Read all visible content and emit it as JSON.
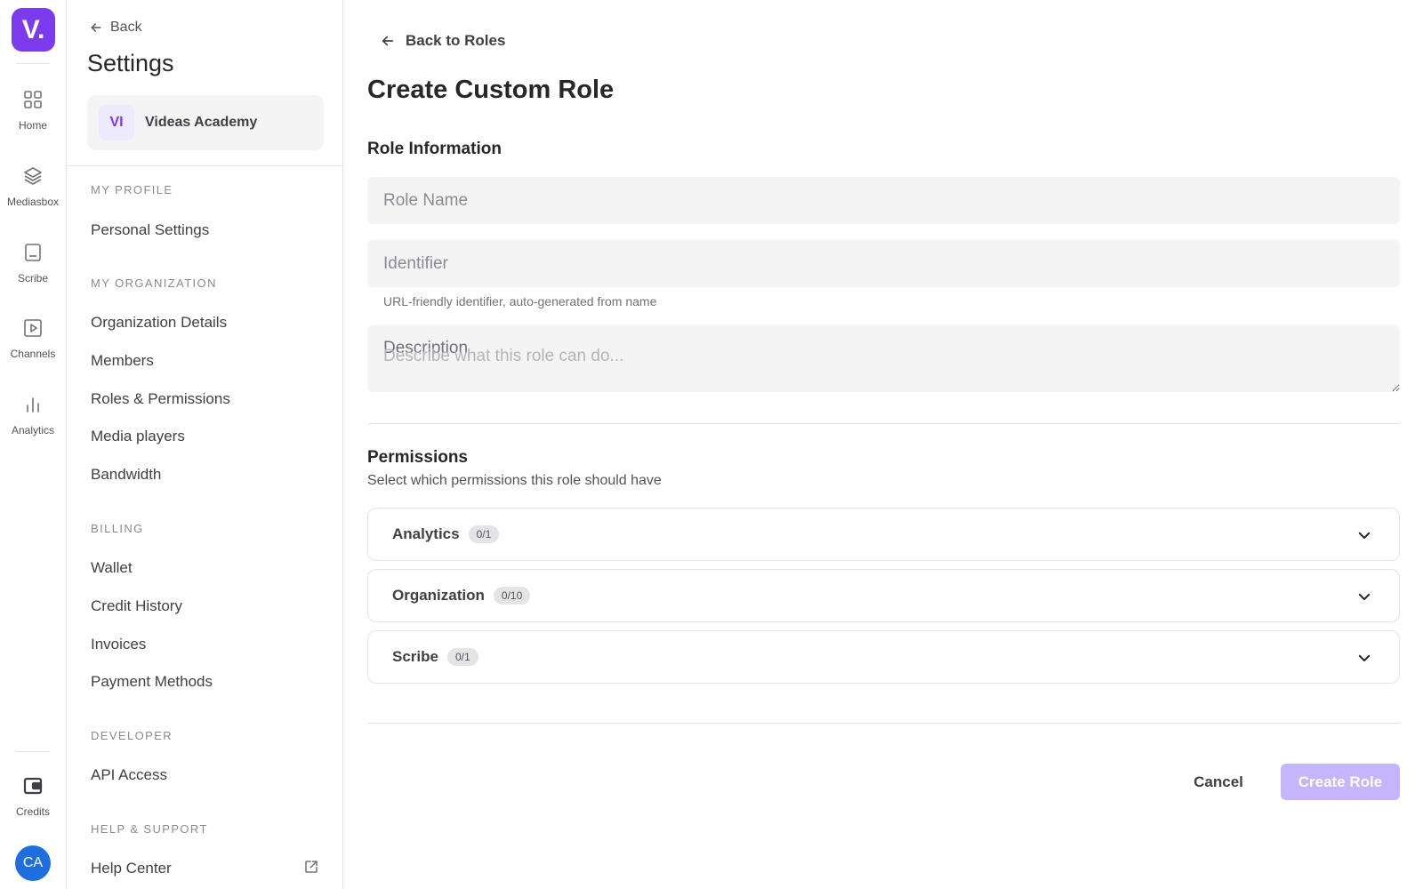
{
  "rail": {
    "logo": "V.",
    "items": [
      {
        "label": "Home",
        "icon": "grid-icon"
      },
      {
        "label": "Mediasbox",
        "icon": "layers-icon"
      },
      {
        "label": "Scribe",
        "icon": "document-icon"
      },
      {
        "label": "Channels",
        "icon": "play-icon"
      },
      {
        "label": "Analytics",
        "icon": "bar-chart-icon"
      }
    ],
    "credits": {
      "label": "Credits",
      "icon": "wallet-icon"
    },
    "avatar": "CA"
  },
  "sidebar": {
    "back": "Back",
    "title": "Settings",
    "org": {
      "badge": "VI",
      "name": "Videas Academy"
    },
    "sections": [
      {
        "title": "MY PROFILE",
        "items": [
          "Personal Settings"
        ]
      },
      {
        "title": "MY ORGANIZATION",
        "items": [
          "Organization Details",
          "Members",
          "Roles & Permissions",
          "Media players",
          "Bandwidth"
        ]
      },
      {
        "title": "BILLING",
        "items": [
          "Wallet",
          "Credit History",
          "Invoices",
          "Payment Methods"
        ]
      },
      {
        "title": "DEVELOPER",
        "items": [
          "API Access"
        ]
      },
      {
        "title": "HELP & SUPPORT",
        "items": [
          "Help Center"
        ]
      }
    ]
  },
  "main": {
    "back": "Back to Roles",
    "title": "Create Custom Role",
    "role_info": {
      "title": "Role Information",
      "role_name_placeholder": "Role Name",
      "identifier_placeholder": "Identifier",
      "identifier_help": "URL-friendly identifier, auto-generated from name",
      "description_label": "Description",
      "description_placeholder": "Describe what this role can do..."
    },
    "permissions": {
      "title": "Permissions",
      "subtitle": "Select which permissions this role should have",
      "groups": [
        {
          "name": "Analytics",
          "count": "0/1"
        },
        {
          "name": "Organization",
          "count": "0/10"
        },
        {
          "name": "Scribe",
          "count": "0/1"
        }
      ]
    },
    "actions": {
      "cancel": "Cancel",
      "create": "Create Role"
    }
  },
  "colors": {
    "accent": "#7c3aed",
    "accent_light": "#c4b5fd",
    "avatar": "#1d6fe0"
  }
}
